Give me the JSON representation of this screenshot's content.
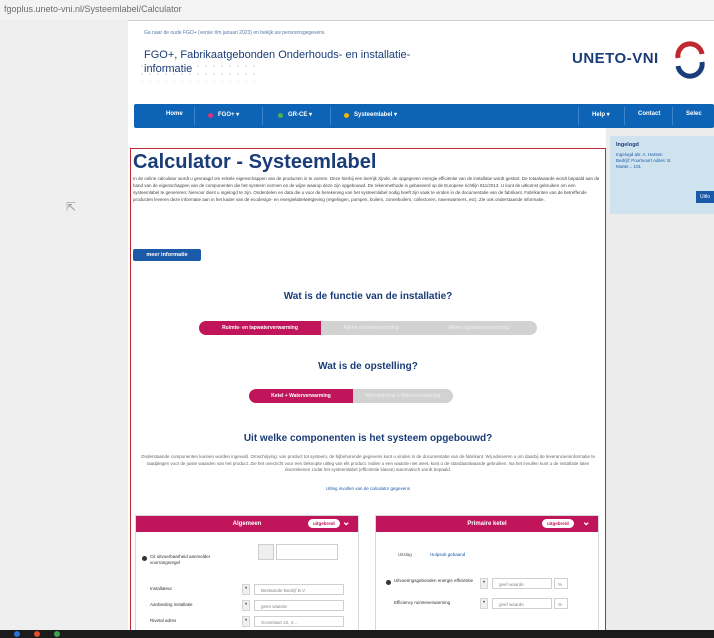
{
  "browser": {
    "url": "fgoplus.uneto-vni.nl/Systeemlabel/Calculator"
  },
  "header": {
    "top_note": "Ga naar de oude FGO+ (versie t/m januari 2023) en bekijk uw persoonsgegevens",
    "site_name": "FGO+, Fabrikaatgebonden Onderhouds- en installatie-informatie",
    "brand": "UNETO-VNI"
  },
  "nav": {
    "items": [
      {
        "label": "Home"
      },
      {
        "label": "FGO+ ▾",
        "icon": "dot-pink"
      },
      {
        "label": "GR-CE ▾",
        "icon": "dot-green"
      },
      {
        "label": "Systeemlabel ▾",
        "icon": "dot-yellow"
      },
      {
        "label": "Help ▾"
      },
      {
        "label": "Contact"
      },
      {
        "label": "Selec"
      }
    ],
    "colors": {
      "bar": "#0d63b5"
    }
  },
  "main": {
    "title": "Calculator - Systeemlabel",
    "intro": "In de online calculator wordt u gevraagd om enkele eigenschappen van de producten in te voeren. Deze hierbij een leerrijk zijnde, de opgegeven energie efficiëntie van de installatie wordt gestart. De totaalwaarde wordt bepaald aan de hand van de eigenschappen van de componenten die het systeem vormen en de wijze waarop deze zijn opgebouwd. De rekenmethode is gebaseerd op de Europese richtlijn 811/2013. U kunt de uitkomst gebruiken om een systeemlabel te genereren; hiervoor dient u ingelogd te zijn. Onderdelen en data die u voor de berekening van het systeemlabel nodig heeft zijn vaak te vinden in de documentatie van de fabrikant. Fabrikanten van de betreffende producten leveren deze informatie aan in het kader van de ecodesign- en energielabelwetgeving (regelingen, pompen, boilers, zonneboilers, collectoren, naverwarmers, etc). Zie ook onderstaande informatie.",
    "more_info": "meer informatie",
    "question1": "Wat is de functie van de installatie?",
    "function_options": [
      {
        "label": "Ruimte- en tapwaterverwarming",
        "active": true
      },
      {
        "label": "Alleen ruimteverwarming",
        "active": false
      },
      {
        "label": "Alleen tapwaterverwarming",
        "active": false
      }
    ],
    "question2": "Wat is de opstelling?",
    "setup_options": [
      {
        "label": "Ketel + Waterverwarming",
        "active": true
      },
      {
        "label": "Warmtepomp + Waterverwarming",
        "active": false
      }
    ],
    "question3": "Uit welke componenten is het systeem opgebouwd?",
    "components_desc": "Onderstaande componenten kunnen worden ingevuld. Omschrijving: van product tot systeem, de bijbehorende gegevens kunt u vinden in de documentatie van de fabrikant. Wij adviseren u om daarbij de leveranciersinformatie te raadplegen voor de juiste waarden van het product. Zie het overzicht voor een beknopte uitleg van elk product. Indien u een waarde niet weet, kunt u de standaardwaarde gebruiken. Na het invullen kunt u de installatie laten doorrekenen zodat het systeemlabel (efficiëntie klasse) automatisch wordt bepaald.",
    "components_link": "Uitleg invullen van de calculator gegevens",
    "accent": "#c0155a"
  },
  "panel_left": {
    "title": "Algemeen",
    "badge": "uitgebreid",
    "rows": [
      {
        "label": "Cit uitvoerbaarheid aanmelder voorrangsregel",
        "value": ""
      },
      {
        "label": "Installateur",
        "value": "Bestaande Bedrijf B.V."
      },
      {
        "label": "Aanbieding installatie",
        "value": "geen waarde"
      },
      {
        "label": "Rivetal adres",
        "value": "Groenlaan 22, 4..."
      }
    ]
  },
  "panel_right": {
    "title": "Primaire ketel",
    "badge": "uitgebreid",
    "tabs": [
      "Uitslag",
      "Hulpsub gebaand"
    ],
    "rows": [
      {
        "label": "Uitvoeringsgebonden energie efficiëntie",
        "value": "geef waarde"
      },
      {
        "label": "Efficiency ruimteverwarming",
        "value": "geef waarde"
      }
    ]
  },
  "login": {
    "heading": "Ingelogd",
    "text": "Ingelogd als: A. Harsen Bedrijf: Poortvoort Adres: B. Mutter... 101",
    "button": "Uitlo"
  }
}
